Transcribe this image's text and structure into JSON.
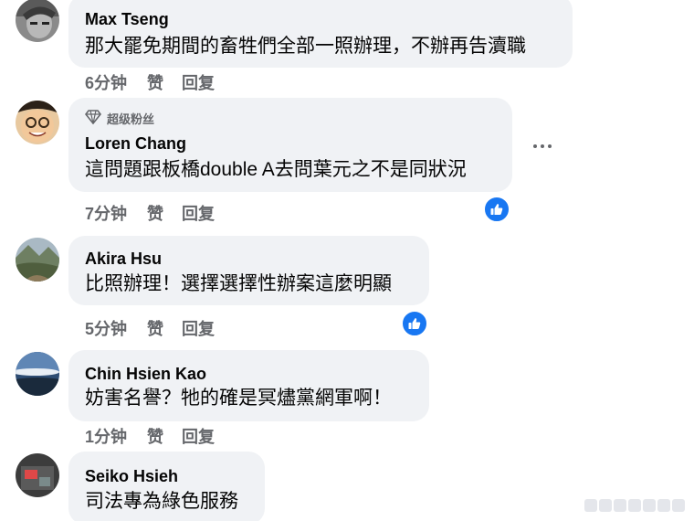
{
  "comments": [
    {
      "name": "Max Tseng",
      "text": "那大罷免期間的畜牲們全部一照辦理，不辦再告瀆職",
      "time": "6分钟",
      "like": "赞",
      "reply": "回复"
    },
    {
      "badge": "超级粉丝",
      "name": "Loren Chang",
      "text": "這問題跟板橋double A去問葉元之不是同狀況",
      "time": "7分钟",
      "like": "赞",
      "reply": "回复"
    },
    {
      "name": "Akira Hsu",
      "text": "比照辦理！選擇選擇性辦案這麼明顯",
      "time": "5分钟",
      "like": "赞",
      "reply": "回复"
    },
    {
      "name": "Chin Hsien Kao",
      "text": "妨害名譽？牠的確是冥燼黨網軍啊！",
      "time": "1分钟",
      "like": "赞",
      "reply": "回复"
    },
    {
      "name": "Seiko Hsieh",
      "text": "司法專為綠色服務"
    }
  ],
  "colors": {
    "bubble": "#f0f2f5",
    "secondary_text": "#65676b",
    "like_blue": "#1877f2"
  },
  "icons": [
    "diamond-icon",
    "thumbs-up-icon",
    "more-options-icon"
  ]
}
